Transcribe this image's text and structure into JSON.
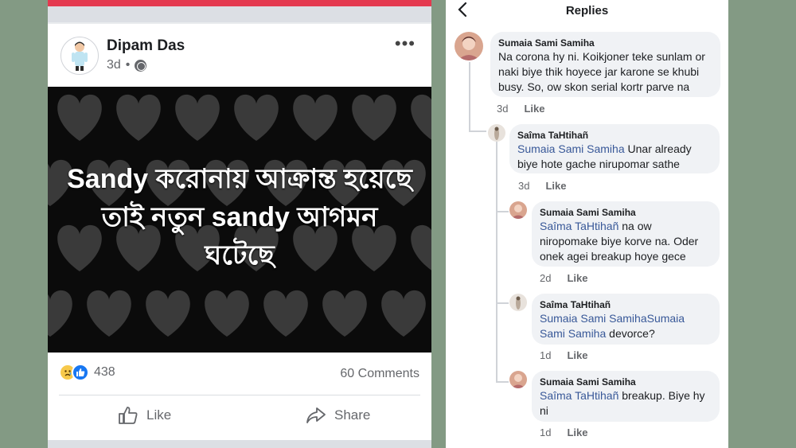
{
  "post": {
    "author": "Dipam Das",
    "time": "3d",
    "meta_separator": "•",
    "more_label": "•••",
    "caption": "Sandy করোনায় আক্রান্ত হয়েছে তাই নতুন sandy আগমন ঘটেছে",
    "reaction_count": "438",
    "comments_count": "60 Comments",
    "like_label": "Like",
    "share_label": "Share",
    "colors": {
      "topbar": "#e4394f",
      "image_bg": "#0b0b0b",
      "heart": "#3a3a3a"
    }
  },
  "replies": {
    "title": "Replies",
    "like_label": "Like",
    "comments": [
      {
        "author": "Sumaia Sami Samiha",
        "mention": "",
        "text": "Na corona hy ni. Koikjoner teke sunlam or naki biye thik hoyece jar karone se khubi busy. So, ow skon serial kortr parve na",
        "time": "3d"
      },
      {
        "author": "Saîma TaHtihañ",
        "mention": "Sumaia Sami Samiha",
        "text": " Unar already biye hote gache nirupomar sathe",
        "time": "3d"
      },
      {
        "author": "Sumaia Sami Samiha",
        "mention": "Saîma TaHtihañ",
        "text": " na ow niropomake biye korve na. Oder onek agei breakup hoye gece",
        "time": "2d"
      },
      {
        "author": "Saîma TaHtihañ",
        "mention": "Sumaia Sami SamihaSumaia Sami Samiha",
        "text": " devorce?",
        "time": "1d"
      },
      {
        "author": "Sumaia Sami Samiha",
        "mention": "Saîma TaHtihañ",
        "text": " breakup. Biye hy ni",
        "time": "1d"
      }
    ]
  }
}
